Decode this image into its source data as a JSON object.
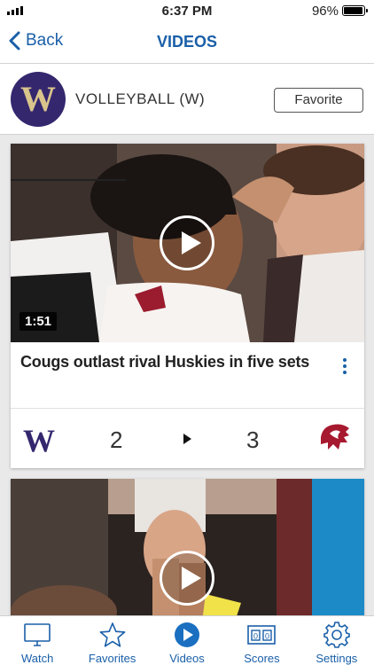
{
  "status": {
    "time": "6:37 PM",
    "battery": "96%"
  },
  "nav": {
    "back_label": "Back",
    "title": "VIDEOS"
  },
  "team": {
    "logo_letter": "W",
    "name": "VOLLEYBALL (W)",
    "favorite_label": "Favorite"
  },
  "videos": [
    {
      "duration": "1:51",
      "title": "Cougs outlast rival Huskies in five sets",
      "home": {
        "logo_letter": "W",
        "score": "2"
      },
      "away": {
        "score": "3"
      }
    },
    {
      "duration": "",
      "title": ""
    }
  ],
  "tabs": [
    {
      "label": "Watch",
      "icon": "monitor-icon"
    },
    {
      "label": "Favorites",
      "icon": "star-icon"
    },
    {
      "label": "Videos",
      "icon": "play-circle-icon",
      "active": true
    },
    {
      "label": "Scores",
      "icon": "scoreboard-icon"
    },
    {
      "label": "Settings",
      "icon": "gear-icon"
    }
  ],
  "colors": {
    "accent": "#1a5fa8",
    "husky_purple": "#34276e",
    "husky_gold": "#d9c48c",
    "cougar_crimson": "#a6192e"
  }
}
